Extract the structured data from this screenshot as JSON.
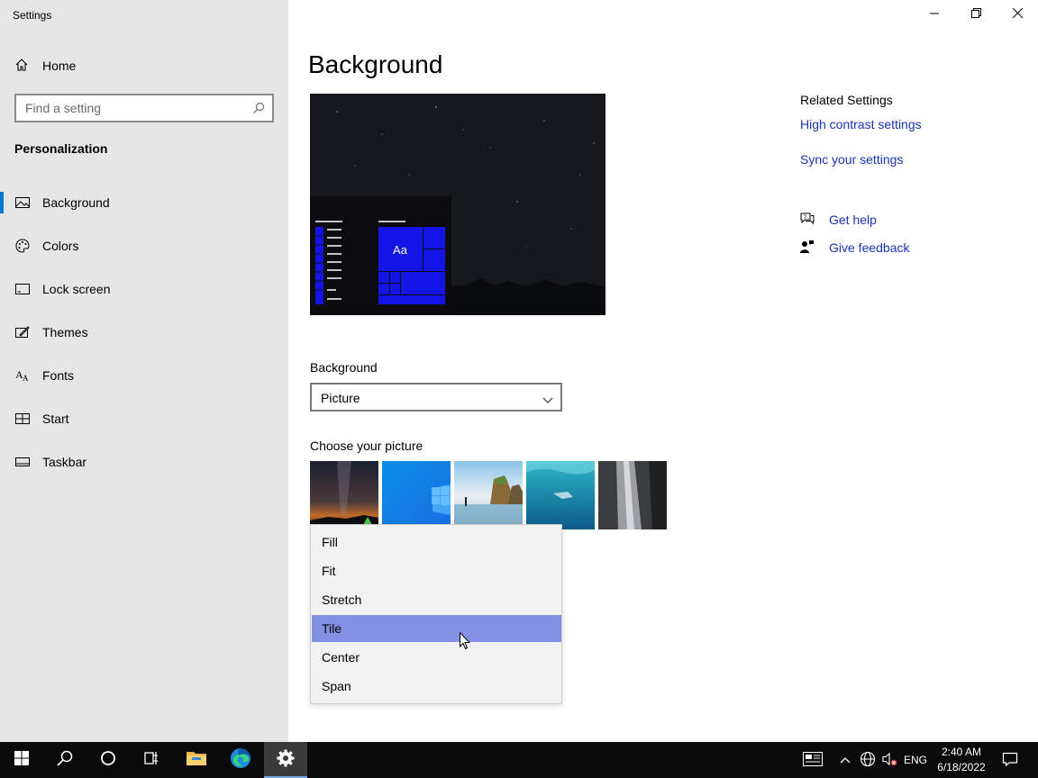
{
  "window": {
    "title": "Settings"
  },
  "sidebar": {
    "home_label": "Home",
    "search_placeholder": "Find a setting",
    "section_title": "Personalization",
    "items": [
      {
        "label": "Background",
        "icon": "picture-icon",
        "active": true
      },
      {
        "label": "Colors",
        "icon": "palette-icon"
      },
      {
        "label": "Lock screen",
        "icon": "lock-screen-icon"
      },
      {
        "label": "Themes",
        "icon": "themes-brush-icon"
      },
      {
        "label": "Fonts",
        "icon": "fonts-icon"
      },
      {
        "label": "Start",
        "icon": "start-tiles-icon"
      },
      {
        "label": "Taskbar",
        "icon": "taskbar-icon"
      }
    ]
  },
  "main": {
    "title": "Background",
    "preview": {
      "tile_label": "Aa"
    },
    "background_label": "Background",
    "background_value": "Picture",
    "choose_picture_label": "Choose your picture",
    "fit_options": [
      "Fill",
      "Fit",
      "Stretch",
      "Tile",
      "Center",
      "Span"
    ],
    "fit_selected": "Tile"
  },
  "related": {
    "title": "Related Settings",
    "links": [
      "High contrast settings",
      "Sync your settings"
    ],
    "get_help": "Get help",
    "give_feedback": "Give feedback"
  },
  "taskbar": {
    "language": "ENG",
    "time": "2:40 AM",
    "date": "6/18/2022"
  },
  "colors": {
    "accent": "#0078d7",
    "preview_tile_blue": "#1414e6",
    "menu_highlight": "#8291e3",
    "link": "#1a33b3"
  }
}
